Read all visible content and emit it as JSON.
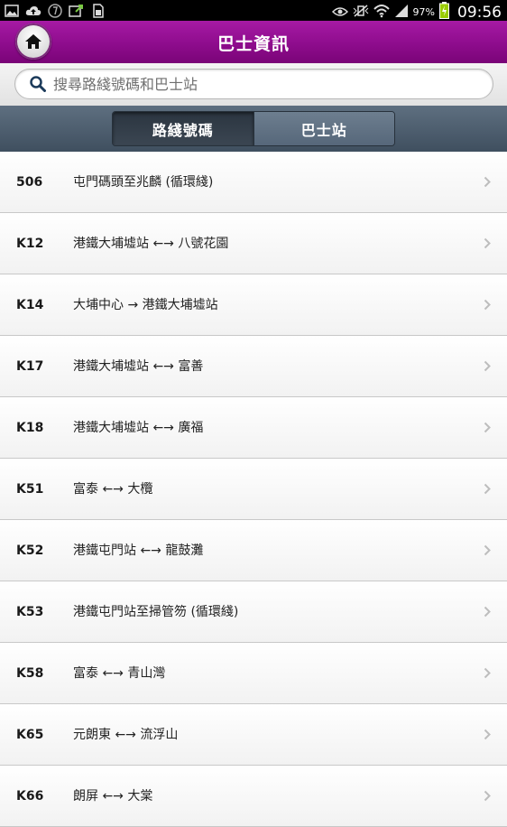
{
  "status_bar": {
    "battery_percent": "97%",
    "time": "09:56"
  },
  "header": {
    "title": "巴士資訊"
  },
  "search": {
    "placeholder": "搜尋路綫號碼和巴士站"
  },
  "tabs": [
    {
      "label": "路綫號碼",
      "active": true
    },
    {
      "label": "巴士站",
      "active": false
    }
  ],
  "routes": [
    {
      "number": "506",
      "description": "屯門碼頭至兆麟 (循環綫)"
    },
    {
      "number": "K12",
      "description": "港鐵大埔墟站 ←→ 八號花園"
    },
    {
      "number": "K14",
      "description": "大埔中心 → 港鐵大埔墟站"
    },
    {
      "number": "K17",
      "description": "港鐵大埔墟站 ←→ 富善"
    },
    {
      "number": "K18",
      "description": "港鐵大埔墟站 ←→ 廣福"
    },
    {
      "number": "K51",
      "description": "富泰 ←→ 大欖"
    },
    {
      "number": "K52",
      "description": "港鐵屯門站 ←→ 龍鼓灘"
    },
    {
      "number": "K53",
      "description": "港鐵屯門站至掃管笏 (循環綫)"
    },
    {
      "number": "K58",
      "description": "富泰 ←→ 青山灣"
    },
    {
      "number": "K65",
      "description": "元朗東 ←→ 流浮山"
    },
    {
      "number": "K66",
      "description": "朗屏 ←→ 大棠"
    }
  ]
}
